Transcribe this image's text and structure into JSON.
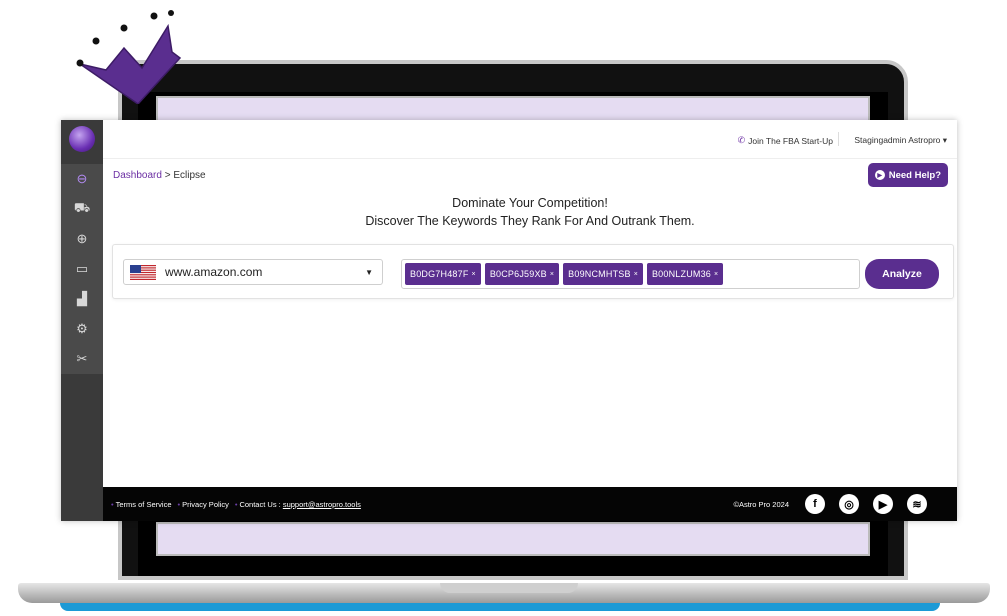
{
  "topbar": {
    "join_label": "Join The FBA Start-Up",
    "user_label": "Stagingadmin Astropro ▾"
  },
  "breadcrumb": {
    "root": "Dashboard",
    "separator": ">",
    "current": "Eclipse"
  },
  "help_button": {
    "label": "Need Help?"
  },
  "headline": {
    "line1": "Dominate Your Competition!",
    "line2": "Discover The Keywords They Rank For And Outrank Them."
  },
  "search": {
    "marketplace": "www.amazon.com",
    "asins": [
      "B0DG7H487F",
      "B0CP6J59XB",
      "B09NCMHTSB",
      "B00NLZUM36"
    ],
    "chip_remove": "×",
    "analyze_label": "Analyze"
  },
  "sidebar": {
    "items": [
      {
        "icon": "eclipse-icon",
        "glyph": "⊖",
        "active": true
      },
      {
        "icon": "cart-icon",
        "glyph": "⛟"
      },
      {
        "icon": "magnify-icon",
        "glyph": "⊕"
      },
      {
        "icon": "window-icon",
        "glyph": "▭"
      },
      {
        "icon": "chart-icon",
        "glyph": "▟"
      },
      {
        "icon": "cogs-icon",
        "glyph": "⚙"
      },
      {
        "icon": "tools-icon",
        "glyph": "✂"
      }
    ]
  },
  "footer": {
    "terms": "Terms of Service",
    "privacy": "Privacy Policy",
    "contact_prefix": "Contact Us :",
    "contact_email": "support@astropro.tools",
    "copyright": "©Astro Pro 2024",
    "socials": [
      {
        "icon": "facebook-icon",
        "glyph": "f"
      },
      {
        "icon": "instagram-icon",
        "glyph": "◎"
      },
      {
        "icon": "youtube-icon",
        "glyph": "▶"
      },
      {
        "icon": "spotify-icon",
        "glyph": "≋"
      }
    ]
  },
  "colors": {
    "accent": "#5a2e8f",
    "sidebar": "#3a3a3a",
    "footer": "#050505"
  }
}
